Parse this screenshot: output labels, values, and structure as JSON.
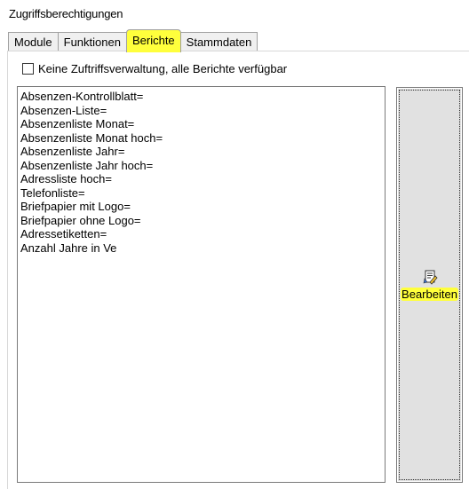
{
  "group": {
    "title": "Zugriffsberechtigungen"
  },
  "tabs": [
    {
      "label": "Module",
      "active": false
    },
    {
      "label": "Funktionen",
      "active": false
    },
    {
      "label": "Berichte",
      "active": true
    },
    {
      "label": "Stammdaten",
      "active": false
    }
  ],
  "checkbox": {
    "label": "Keine Zuftriffsverwaltung, alle Berichte verfügbar",
    "checked": false
  },
  "reports": [
    "Absenzen-Kontrollblatt=",
    "Absenzen-Liste=",
    "Absenzenliste Monat=",
    "Absenzenliste Monat hoch=",
    "Absenzenliste Jahr=",
    "Absenzenliste Jahr hoch=",
    "Adressliste hoch=",
    "Telefonliste=",
    "Briefpapier mit Logo=",
    "Briefpapier ohne Logo=",
    "Adressetiketten=",
    "Anzahl Jahre in Ve"
  ],
  "edit_button": {
    "label": "Bearbeiten",
    "icon": "edit-document-icon"
  },
  "colors": {
    "highlight": "#ffff3c",
    "button_face": "#e1e1e1",
    "border": "#7a7a7a"
  }
}
